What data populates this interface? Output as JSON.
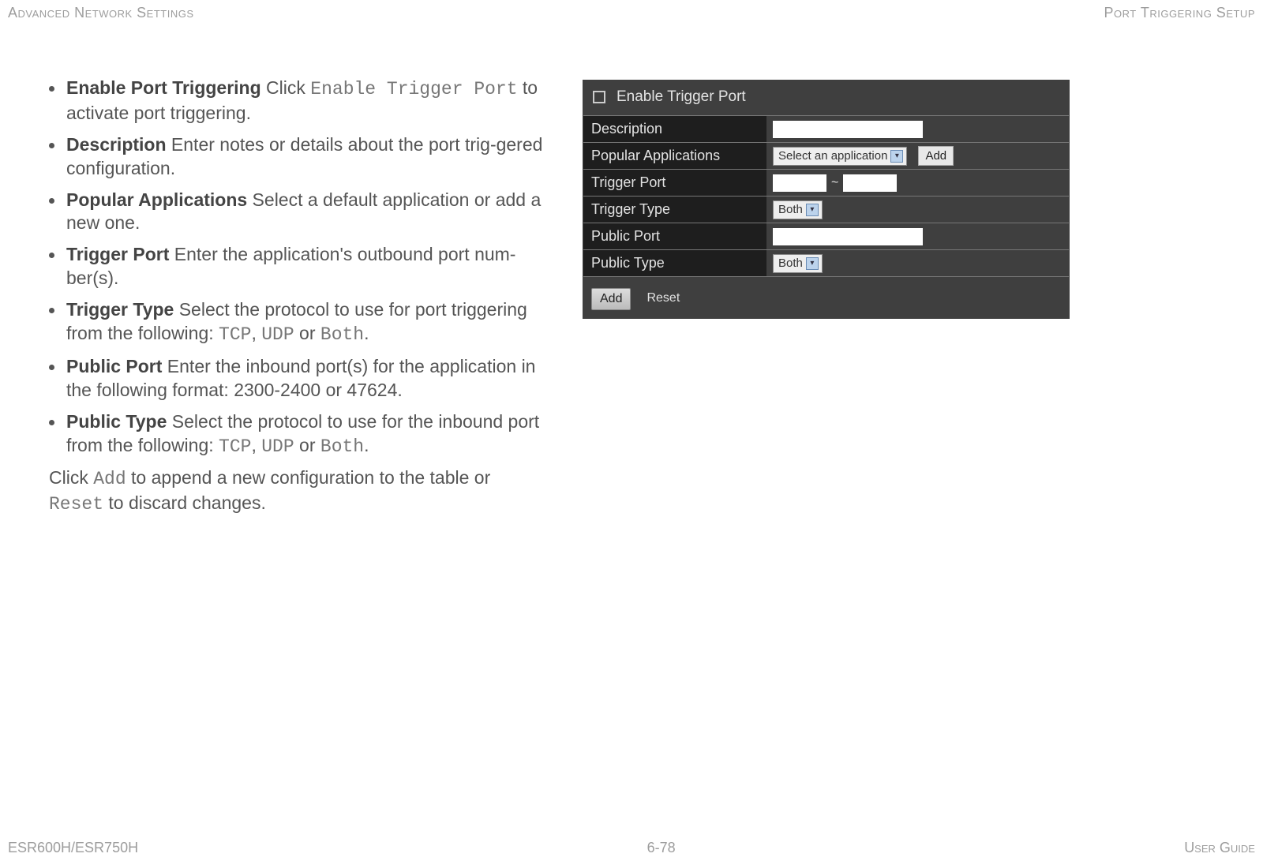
{
  "header": {
    "left": "Advanced Network Settings",
    "right": "Port Triggering Setup"
  },
  "bullets": [
    {
      "term": "Enable Port Triggering",
      "pre": "  Click ",
      "mono": "Enable Trigger Port",
      "post": " to activate port triggering."
    },
    {
      "term": "Description",
      "pre": "  Enter notes or details about the port trig-gered configuration."
    },
    {
      "term": "Popular Applications",
      "pre": "  Select a default application or add a new one."
    },
    {
      "term": "Trigger Port",
      "pre": "  Enter the application's outbound port num-ber(s)."
    },
    {
      "term": "Trigger Type",
      "pre": "  Select the protocol to use for port triggering from the following: ",
      "mono": "TCP",
      "mid": ", ",
      "mono2": "UDP",
      "mid2": " or ",
      "mono3": "Both",
      "post": "."
    },
    {
      "term": "Public Port",
      "pre": "  Enter the inbound port(s) for the application in the following format: 2300-2400 or 47624."
    },
    {
      "term": "Public Type",
      "pre": "  Select the protocol to use for the inbound port from the following: ",
      "mono": "TCP",
      "mid": ", ",
      "mono2": "UDP",
      "mid2": " or ",
      "mono3": "Both",
      "post": "."
    }
  ],
  "after": {
    "p1a": "Click ",
    "p1mono": "Add",
    "p1b": " to append a new configuration to the table or ",
    "p2mono": "Reset",
    "p2b": " to discard changes."
  },
  "ui": {
    "check_label": "Enable Trigger Port",
    "rows": {
      "description": "Description",
      "popular": "Popular Applications",
      "trigger_port": "Trigger Port",
      "trigger_type": "Trigger Type",
      "public_port": "Public Port",
      "public_type": "Public Type"
    },
    "select_app": "Select an application",
    "add_btn": "Add",
    "both": "Both",
    "footer_add": "Add",
    "footer_reset": "Reset"
  },
  "footer": {
    "left": "ESR600H/ESR750H",
    "center": "6-78",
    "right": "User Guide"
  }
}
